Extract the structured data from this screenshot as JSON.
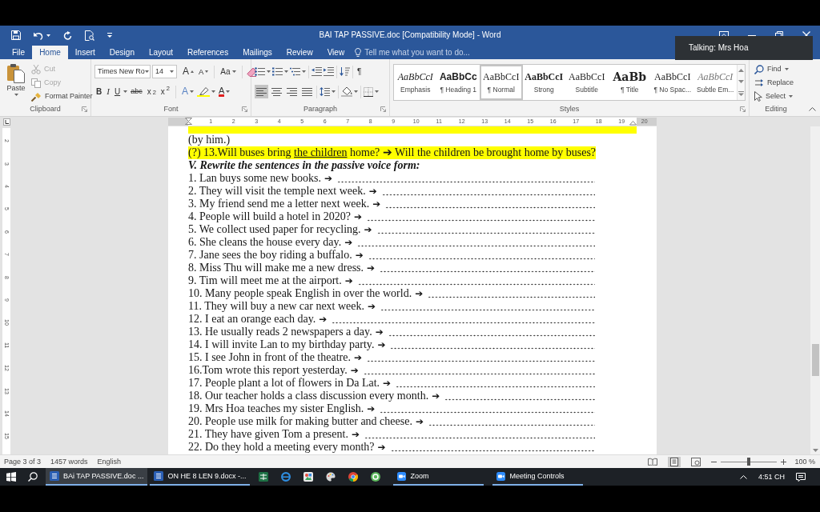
{
  "window": {
    "title": "BAI TAP PASSIVE.doc [Compatibility Mode] - Word"
  },
  "notification": {
    "text": "Talking: Mrs Hoa"
  },
  "ribbon_tabs": [
    {
      "label": "File",
      "selected": false
    },
    {
      "label": "Home",
      "selected": true
    },
    {
      "label": "Insert",
      "selected": false
    },
    {
      "label": "Design",
      "selected": false
    },
    {
      "label": "Layout",
      "selected": false
    },
    {
      "label": "References",
      "selected": false
    },
    {
      "label": "Mailings",
      "selected": false
    },
    {
      "label": "Review",
      "selected": false
    },
    {
      "label": "View",
      "selected": false
    }
  ],
  "tell_me": {
    "placeholder": "Tell me what you want to do..."
  },
  "clipboard": {
    "paste": "Paste",
    "items": [
      {
        "kind": "cut",
        "label": "Cut",
        "disabled": true
      },
      {
        "kind": "copy",
        "label": "Copy",
        "disabled": true
      },
      {
        "kind": "format_painter",
        "label": "Format Painter",
        "disabled": false
      }
    ],
    "group_label": "Clipboard"
  },
  "font": {
    "name": "Times New Ro",
    "size": "14",
    "grow": "A",
    "shrink": "A",
    "change_case": "Aa",
    "bold": "B",
    "italic": "I",
    "underline": "U",
    "strikethrough": "abc",
    "subscript": "x$_{2}$",
    "superscript": "x$^{2}$",
    "text_effects": "A",
    "font_color": "A",
    "group_label": "Font"
  },
  "paragraph": {
    "show_marks": "¶",
    "alignment": [
      {
        "kind": "left",
        "selected": true
      },
      {
        "kind": "center",
        "selected": false
      },
      {
        "kind": "right",
        "selected": false
      },
      {
        "kind": "justify",
        "selected": false
      }
    ],
    "group_label": "Paragraph"
  },
  "styles": {
    "items": [
      {
        "kind": "emphasis",
        "preview": "AaBbCcI",
        "name": "Emphasis",
        "selected": false
      },
      {
        "kind": "heading",
        "preview": "AaBbCc",
        "name": "¶ Heading 1",
        "selected": false
      },
      {
        "kind": "normal",
        "preview": "AaBbCcI",
        "name": "¶ Normal",
        "selected": true
      },
      {
        "kind": "strong",
        "preview": "AaBbCcI",
        "name": "Strong",
        "selected": false
      },
      {
        "kind": "subtitle",
        "preview": "AaBbCcI",
        "name": "Subtitle",
        "selected": false
      },
      {
        "kind": "title",
        "preview": "AaBb",
        "name": "¶ Title",
        "selected": false
      },
      {
        "kind": "plain",
        "preview": "AaBbCcI",
        "name": "¶ No Spac...",
        "selected": false
      },
      {
        "kind": "subtle",
        "preview": "AaBbCcI",
        "name": "Subtle Em...",
        "selected": false
      }
    ],
    "group_label": "Styles"
  },
  "editing": {
    "items": [
      {
        "kind": "find",
        "label": "Find"
      },
      {
        "kind": "replace",
        "label": "Replace"
      },
      {
        "kind": "select",
        "label": "Select"
      }
    ],
    "group_label": "Editing"
  },
  "ruler": {
    "horizontal": [
      "1",
      "2",
      "3",
      "4",
      "5",
      "6",
      "7",
      "8",
      "9",
      "10",
      "11",
      "12",
      "13",
      "14",
      "15",
      "16",
      "17",
      "18",
      "19",
      "20"
    ],
    "vertical": [
      "2",
      "3",
      "4",
      "5",
      "6",
      "7",
      "8",
      "9",
      "10",
      "11",
      "12",
      "13",
      "14",
      "15"
    ]
  },
  "document": {
    "lines": [
      {
        "kind": "cut_off",
        "highlighted": true
      },
      {
        "kind": "text",
        "highlighted": false,
        "segments": [
          {
            "text": "(by him.)",
            "underlined": false
          }
        ]
      },
      {
        "kind": "text",
        "highlighted": true,
        "segments": [
          {
            "text": "(?) 13.Will buses bring ",
            "underlined": false
          },
          {
            "text": "the children",
            "underlined": true
          },
          {
            "text": " home? ➔ Will the children be brought home by buses?",
            "underlined": false
          }
        ]
      },
      {
        "kind": "heading",
        "text": "V. Rewrite the sentences in the passive voice form:"
      }
    ],
    "exercises": [
      {
        "prompt": "1. Lan buys some new books.",
        "arrow": "➔"
      },
      {
        "prompt": "2. They will visit the temple next week.",
        "arrow": "➔"
      },
      {
        "prompt": "3. My friend send me a letter next week.",
        "arrow": "➔"
      },
      {
        "prompt": "4. People will build a hotel in 2020?",
        "arrow": "➔"
      },
      {
        "prompt": "5. We collect used paper for recycling.",
        "arrow": "➔"
      },
      {
        "prompt": "6. She cleans the house every day.",
        "arrow": "➔"
      },
      {
        "prompt": "7. Jane sees the boy riding a buffalo.",
        "arrow": "➔"
      },
      {
        "prompt": "8. Miss Thu will make me a new dress.",
        "arrow": "➔"
      },
      {
        "prompt": "9. Tim will meet me at the airport.",
        "arrow": "➔"
      },
      {
        "prompt": "10. Many people speak English in over the world.",
        "arrow": "➔"
      },
      {
        "prompt": "11. They will buy a new car next week.",
        "arrow": "➔"
      },
      {
        "prompt": "12. I eat an orange each day.",
        "arrow": "➔"
      },
      {
        "prompt": "13. He usually reads 2 newspapers a day.",
        "arrow": "➔"
      },
      {
        "prompt": "14. I will invite Lan to my birthday party.",
        "arrow": "➔"
      },
      {
        "prompt": "15. I see John in front of the theatre.",
        "arrow": "➔"
      },
      {
        "prompt": "16.Tom wrote this report yesterday.",
        "arrow": "➔"
      },
      {
        "prompt": "17. People plant a lot of flowers in Da Lat.",
        "arrow": "➔"
      },
      {
        "prompt": "18. Our teacher holds a class discussion every month.",
        "arrow": "➔"
      },
      {
        "prompt": "19. Mrs Hoa teaches my sister English.",
        "arrow": "➔"
      },
      {
        "prompt": "20. People use milk for making butter and cheese.",
        "arrow": "➔"
      },
      {
        "prompt": "21. They have given Tom a present.",
        "arrow": "➔"
      },
      {
        "prompt": "22. Do they hold a meeting every month?",
        "arrow": "➔"
      }
    ]
  },
  "status_bar": {
    "page": "Page 3 of 3",
    "words": "1457 words",
    "language": "English",
    "views": [
      {
        "kind": "read",
        "selected": false
      },
      {
        "kind": "print",
        "selected": true
      },
      {
        "kind": "web",
        "selected": false
      }
    ],
    "zoom": {
      "level": 0.5,
      "reading": "100 %"
    }
  },
  "taskbar": {
    "items": [
      {
        "kind": "document",
        "label": "BAi TAP PASSIVE.doc ...",
        "selected": true
      },
      {
        "kind": "document",
        "label": "ON HE 8 LEN 9.docx -...",
        "selected": false
      },
      {
        "kind": "spreadsheet",
        "selected": false
      },
      {
        "kind": "browser",
        "selected": false
      },
      {
        "kind": "photos",
        "selected": false
      },
      {
        "kind": "palette",
        "selected": false
      },
      {
        "kind": "ring",
        "selected": false
      },
      {
        "kind": "round",
        "selected": false
      },
      {
        "kind": "video",
        "label": "Zoom",
        "selected": false
      },
      {
        "kind": "video",
        "label": "Meeting Controls",
        "selected": false
      }
    ],
    "clock": "4:51 CH"
  }
}
